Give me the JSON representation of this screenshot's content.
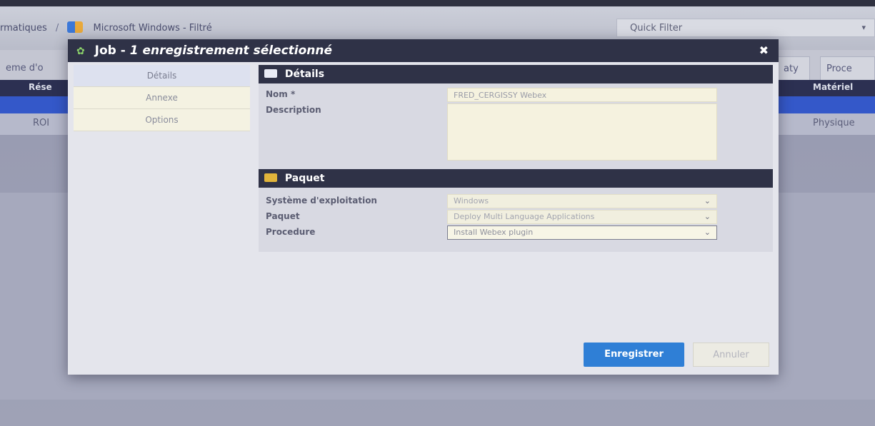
{
  "background": {
    "breadcrumb": {
      "parent": "rmatiques",
      "separator": "/",
      "current": "Microsoft Windows - Filtré"
    },
    "quick_filter": {
      "placeholder": "Quick Filter"
    },
    "tabs": {
      "left_partial": "eme d'o",
      "right_1": "aty",
      "right_2": "Proce"
    },
    "table": {
      "header_left": "Rése",
      "header_right": "Matériel",
      "row": {
        "col1": "ROI",
        "col_right": "Physique"
      }
    }
  },
  "modal": {
    "title": "Job",
    "title_separator": "-",
    "subtitle": "1 enregistrement sélectionné",
    "close_icon": "close-icon",
    "sidebar": [
      {
        "label": "Détails",
        "active": true
      },
      {
        "label": "Annexe",
        "active": false
      },
      {
        "label": "Options",
        "active": false
      }
    ],
    "details": {
      "header": "Détails",
      "name_label": "Nom *",
      "name_value": "FRED_CERGISSY Webex",
      "description_label": "Description",
      "description_value": ""
    },
    "package": {
      "header": "Paquet",
      "os_label": "Système d'exploitation",
      "os_value": "Windows",
      "package_label": "Paquet",
      "package_value": "Deploy Multi Language Applications",
      "procedure_label": "Procedure",
      "procedure_value": "Install Webex plugin"
    },
    "buttons": {
      "save": "Enregistrer",
      "cancel": "Annuler"
    }
  },
  "colors": {
    "title_bar": "#2f3247",
    "primary_button": "#2f7fd6",
    "input_background": "#f5f2df",
    "selected_row": "#3458c9"
  }
}
